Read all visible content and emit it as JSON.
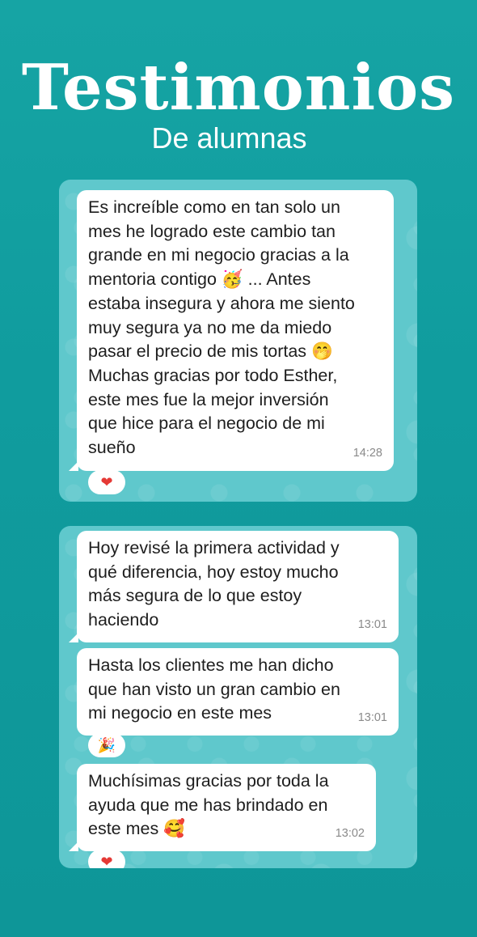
{
  "header": {
    "title": "Testimonios",
    "subtitle": "De alumnas"
  },
  "colors": {
    "background": "#109c9e",
    "chat_bg": "#5fc8cc",
    "bubble": "#ffffff",
    "timestamp": "#8a8a8a",
    "heart": "#e53935"
  },
  "chat1": {
    "messages": [
      {
        "text": "Es increíble como en tan solo un\nmes he logrado este cambio tan\ngrande en mi negocio gracias a la\nmentoria contigo 🥳 ... Antes\nestaba insegura y ahora me siento\nmuy segura ya no me da miedo\npasar el precio de mis tortas 🤭\nMuchas gracias por todo Esther,\neste mes fue la mejor inversión\nque hice para el negocio de mi\nsueño",
        "time": "14:28",
        "reaction": "❤"
      }
    ]
  },
  "chat2": {
    "messages": [
      {
        "text": "Hoy revisé la primera actividad y\nqué diferencia, hoy estoy mucho\nmás segura de lo que estoy\nhaciendo",
        "time": "13:01"
      },
      {
        "text": "Hasta los clientes me han dicho\nque han visto un gran cambio en\nmi negocio en este mes",
        "time": "13:01",
        "reaction": "🎉"
      },
      {
        "text": "Muchísimas gracias por toda la\nayuda que me has brindado en\neste mes 🥰",
        "time": "13:02",
        "reaction": "❤"
      }
    ]
  }
}
